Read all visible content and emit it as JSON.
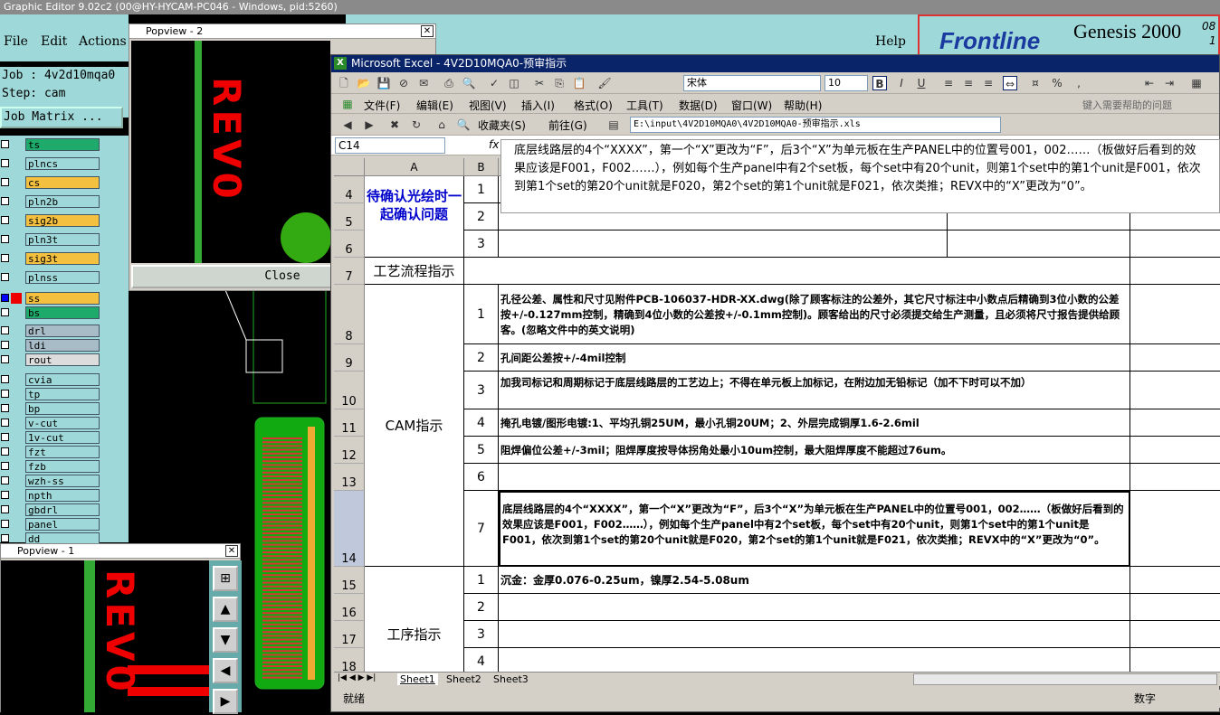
{
  "graphic_editor": {
    "title": "Graphic Editor 9.02c2 (00@HY-HYCAM-PC046 - Windows, pid:5260)",
    "menu": [
      "File",
      "Edit",
      "Actions",
      "Help"
    ],
    "job_label": "Job : 4v2d10mqa0",
    "step_label": "Step: cam",
    "job_matrix": "Job Matrix ...",
    "layers": [
      {
        "name": "ts",
        "color": "#1daa6a"
      },
      {
        "name": "plncs",
        "color": "#9fd8d8"
      },
      {
        "name": "cs",
        "color": "#f4c040"
      },
      {
        "name": "pln2b",
        "color": "#9fd8d8"
      },
      {
        "name": "sig2b",
        "color": "#f4c040"
      },
      {
        "name": "pln3t",
        "color": "#9fd8d8"
      },
      {
        "name": "sig3t",
        "color": "#f4c040"
      },
      {
        "name": "plnss",
        "color": "#9fd8d8"
      },
      {
        "name": "ss",
        "color": "#f4c040"
      },
      {
        "name": "bs",
        "color": "#1daa6a"
      },
      {
        "name": "drl",
        "color": "#a8bcc8"
      },
      {
        "name": "ldi",
        "color": "#a8bcc8"
      },
      {
        "name": "rout",
        "color": "#dcdcdc"
      },
      {
        "name": "cvia",
        "color": "#9fd8d8"
      },
      {
        "name": "tp",
        "color": "#9fd8d8"
      },
      {
        "name": "bp",
        "color": "#9fd8d8"
      },
      {
        "name": "v-cut",
        "color": "#9fd8d8"
      },
      {
        "name": "1v-cut",
        "color": "#9fd8d8"
      },
      {
        "name": "fzt",
        "color": "#9fd8d8"
      },
      {
        "name": "fzb",
        "color": "#9fd8d8"
      },
      {
        "name": "wzh-ss",
        "color": "#9fd8d8"
      },
      {
        "name": "npth",
        "color": "#9fd8d8"
      },
      {
        "name": "gbdrl",
        "color": "#9fd8d8"
      },
      {
        "name": "panel",
        "color": "#9fd8d8"
      },
      {
        "name": "dd",
        "color": "#9fd8d8"
      }
    ],
    "popview2_title": "Popview - 2",
    "popview2_close": "Close",
    "popview1_title": "Popview - 1",
    "board_text": "REV0",
    "frontline": "Frontline",
    "genesis": "Genesis 2000",
    "genesis_sup": "08",
    "genesis_sub": "1"
  },
  "excel": {
    "title": "Microsoft Excel - 4V2D10MQA0-预审指示",
    "font_name": "宋体",
    "font_size": "10",
    "menu": [
      "文件(F)",
      "编辑(E)",
      "视图(V)",
      "插入(I)",
      "格式(O)",
      "工具(T)",
      "数据(D)",
      "窗口(W)",
      "帮助(H)"
    ],
    "help_placeholder": "键入需要帮助的问题",
    "favorites": "收藏夹(S)",
    "goto": "前往(G)",
    "path": "E:\\input\\4V2D10MQA0\\4V2D10MQA0-预审指示.xls",
    "name_box": "C14",
    "fx": "fx",
    "col_a": "A",
    "col_b": "B",
    "tooltip": "底层线路层的4个“XXXX”，第一个“X”更改为“F”，后3个“X”为单元板在生产PANEL中的位置号001，002……（板做好后看到的效果应该是F001，F002……），例如每个生产panel中有2个set板，每个set中有20个unit，则第1个set中的第1个unit是F001，依次到第1个set的第20个unit就是F020，第2个set的第1个unit就是F021，依次类推；REVX中的“X”更改为“0”。",
    "sec_confirm": "待确认光绘时一起确认问题",
    "sec_process": "工艺流程指示",
    "sec_cam": "CAM指示",
    "sec_step": "工序指示",
    "rows": {
      "r4": "4",
      "r5": "5",
      "r6": "6",
      "r7": "7",
      "r8": "8",
      "r9": "9",
      "r10": "10",
      "r11": "11",
      "r12": "12",
      "r13": "13",
      "r14": "14",
      "r15": "15",
      "r16": "16",
      "r17": "17",
      "r18": "18"
    },
    "cam_items": [
      {
        "n": "1",
        "text": "孔径公差、属性和尺寸见附件PCB-106037-HDR-XX.dwg(除了顾客标注的公差外，其它尺寸标注中小数点后精确到3位小数的公差按+/-0.127mm控制，精确到4位小数的公差按+/-0.1mm控制)。顾客给出的尺寸必须提交给生产测量，且必须将尺寸报告提供给顾客。(忽略文件中的英文说明)"
      },
      {
        "n": "2",
        "text": "孔间距公差按+/-4mil控制"
      },
      {
        "n": "3",
        "text": "加我司标记和周期标记于底层线路层的工艺边上；不得在单元板上加标记，在附边加无铅标记（加不下时可以不加）"
      },
      {
        "n": "4",
        "text": "掩孔电镀/图形电镀:1、平均孔铜25UM，最小孔铜20UM；2、外层完成铜厚1.6-2.6mil"
      },
      {
        "n": "5",
        "text": "阻焊偏位公差+/-3mil；阻焊厚度按导体拐角处最小10um控制，最大阻焊厚度不能超过76um。"
      },
      {
        "n": "6",
        "text": ""
      },
      {
        "n": "7",
        "text": "底层线路层的4个“XXXX”，第一个“X”更改为“F”，后3个“X”为单元板在生产PANEL中的位置号001，002……（板做好后看到的效果应该是F001，F002……），例如每个生产panel中有2个set板，每个set中有20个unit，则第1个set中的第1个unit是F001，依次到第1个set的第20个unit就是F020，第2个set的第1个unit就是F021，依次类推；REVX中的“X”更改为“0”。"
      }
    ],
    "step_items": [
      {
        "n": "1",
        "text": "沉金：金厚0.076-0.25um，镍厚2.54-5.08um"
      },
      {
        "n": "2",
        "text": ""
      },
      {
        "n": "3",
        "text": ""
      },
      {
        "n": "4",
        "text": ""
      }
    ],
    "confirm_nums": [
      "1",
      "2",
      "3"
    ],
    "sheets": [
      "Sheet1",
      "Sheet2",
      "Sheet3"
    ],
    "status_left": "就绪",
    "status_right": "数字"
  }
}
